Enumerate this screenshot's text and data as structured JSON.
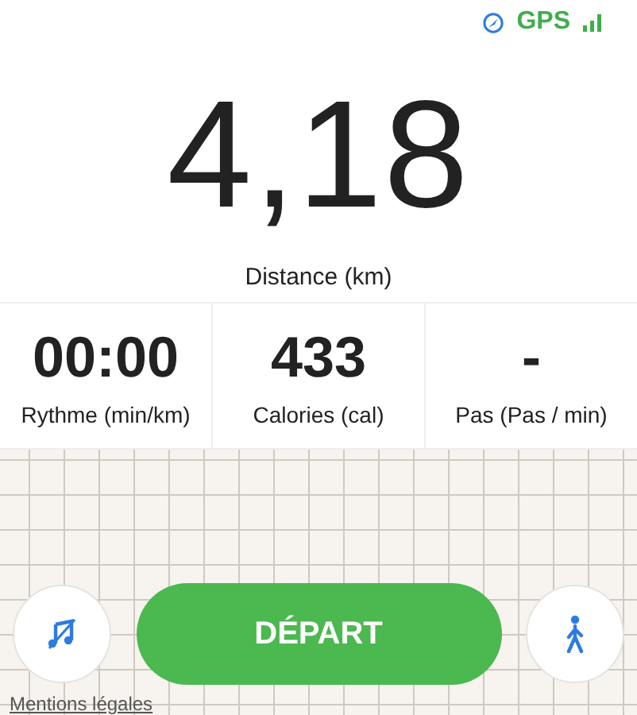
{
  "status_bar": {
    "gps_label": "GPS"
  },
  "main_metric": {
    "value": "4,18",
    "label": "Distance (km)"
  },
  "stats": [
    {
      "value": "00:00",
      "label": "Rythme (min/km)"
    },
    {
      "value": "433",
      "label": "Calories (cal)"
    },
    {
      "value": "-",
      "label": "Pas (Pas / min)"
    }
  ],
  "start_button": {
    "label": "DÉPART"
  },
  "legal_link": "Mentions légales"
}
